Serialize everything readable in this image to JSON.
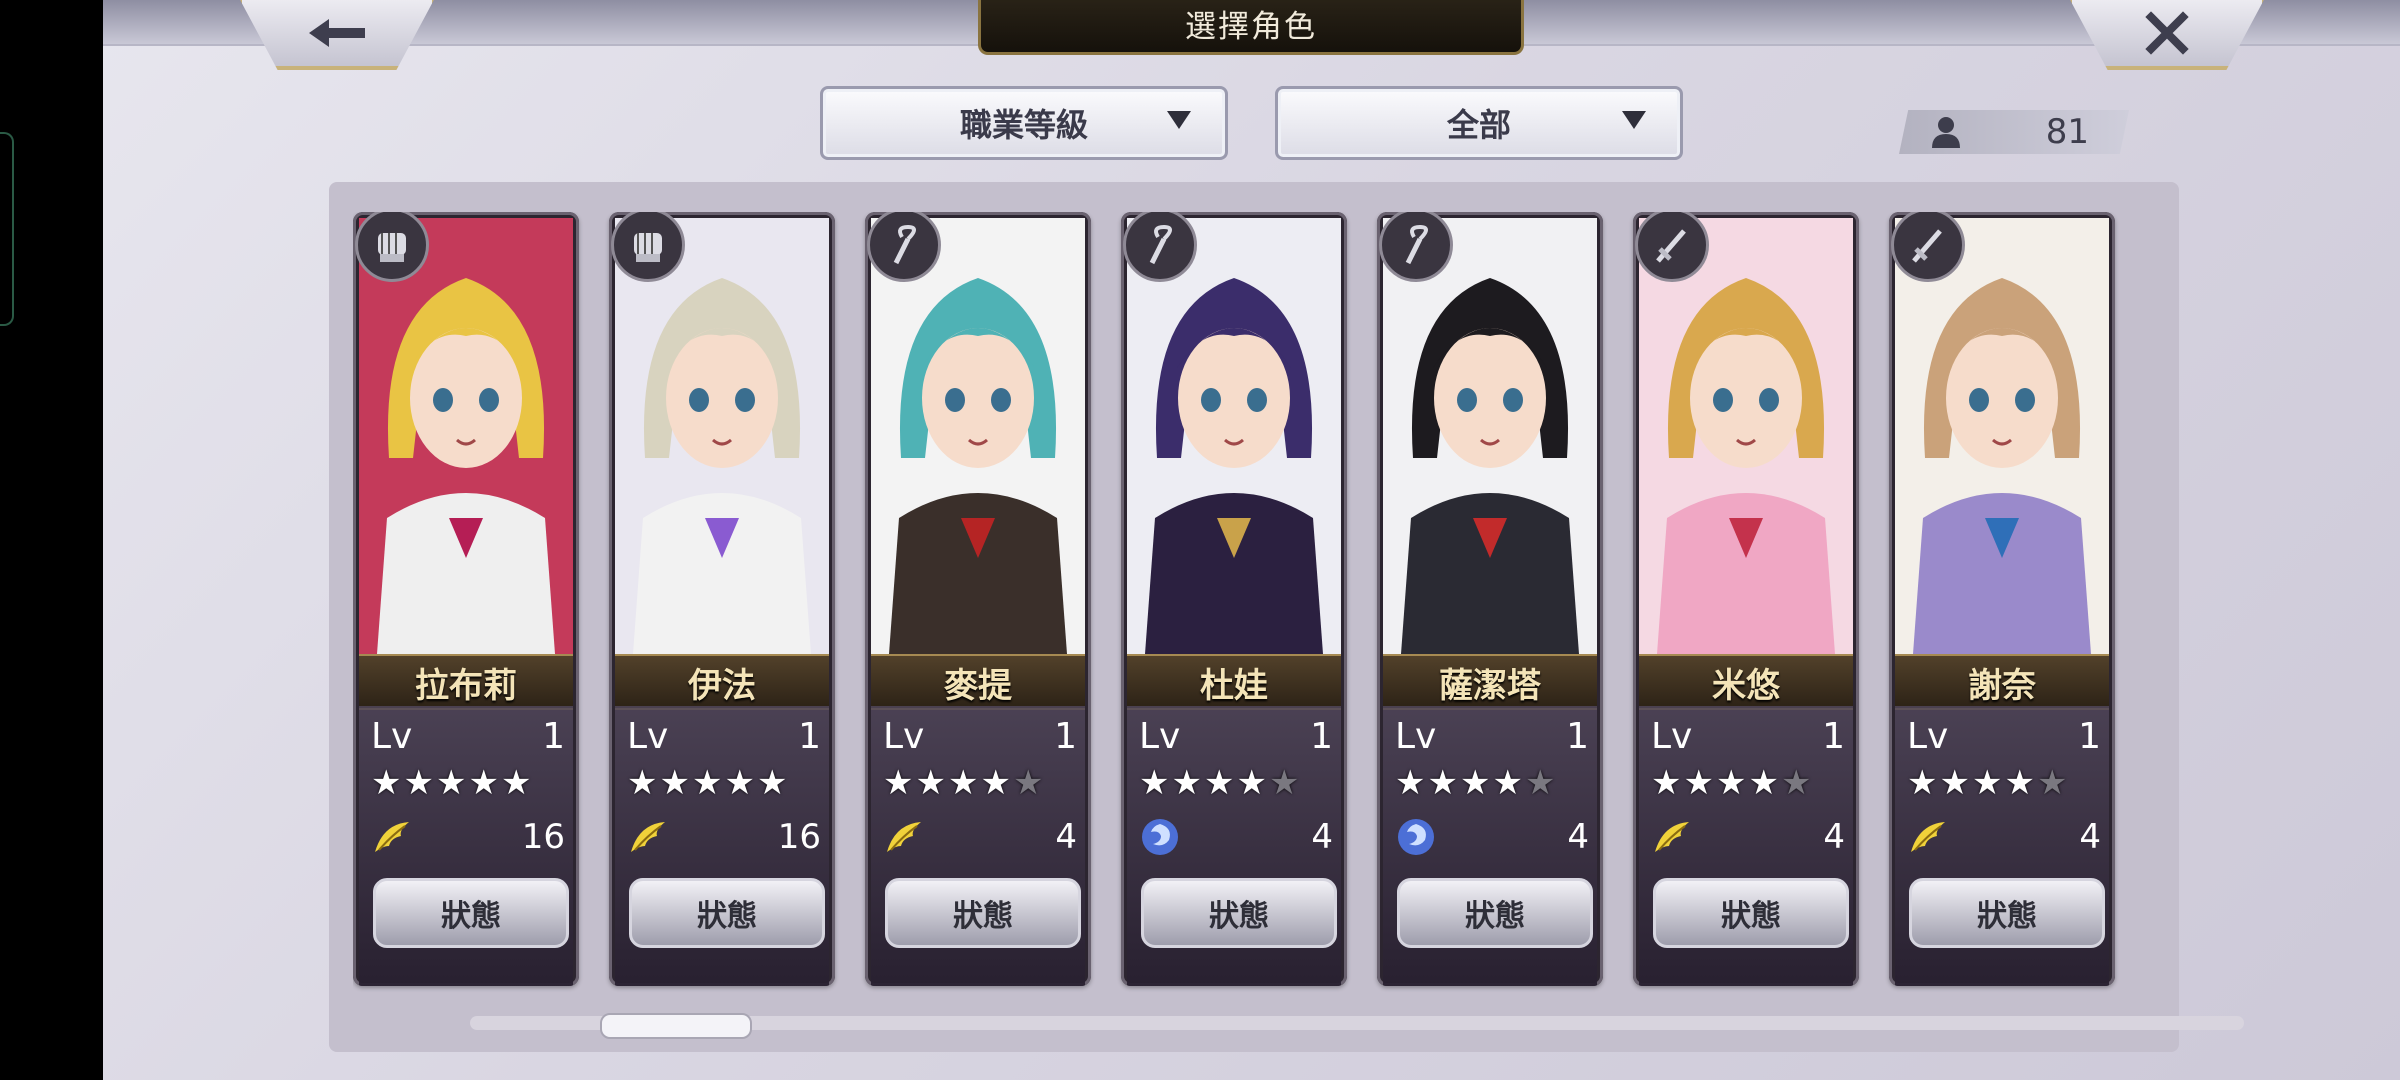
{
  "header": {
    "title": "選擇角色",
    "back_icon": "arrow-left-icon",
    "close_icon": "close-x-icon"
  },
  "filters": {
    "sort_label": "職業等級",
    "filter_label": "全部"
  },
  "roster": {
    "count": "81"
  },
  "cards": [
    {
      "name": "拉布莉",
      "lv_label": "Lv",
      "level": "1",
      "stars": 5,
      "max_stars": 5,
      "element_icon": "wind-leaf-icon",
      "element_value": "16",
      "class_icon": "fist-gauntlet-icon",
      "status_label": "狀態",
      "palette": {
        "hair": "#e9c444",
        "bg": "#c43a5a",
        "outfit": "#efefef",
        "accent": "#b51e55"
      }
    },
    {
      "name": "伊法",
      "lv_label": "Lv",
      "level": "1",
      "stars": 5,
      "max_stars": 5,
      "element_icon": "wind-leaf-icon",
      "element_value": "16",
      "class_icon": "fist-gauntlet-icon",
      "status_label": "狀態",
      "palette": {
        "hair": "#d8d3bf",
        "bg": "#e9e7f0",
        "outfit": "#f2f2f2",
        "accent": "#8a5bd1"
      }
    },
    {
      "name": "麥提",
      "lv_label": "Lv",
      "level": "1",
      "stars": 4,
      "max_stars": 5,
      "element_icon": "wind-leaf-icon",
      "element_value": "4",
      "class_icon": "staff-icon",
      "status_label": "狀態",
      "palette": {
        "hair": "#4fb2b5",
        "bg": "#f3f3f3",
        "outfit": "#3a2f2a",
        "accent": "#b52424"
      }
    },
    {
      "name": "杜娃",
      "lv_label": "Lv",
      "level": "1",
      "stars": 4,
      "max_stars": 5,
      "element_icon": "swirl-water-icon",
      "element_value": "4",
      "class_icon": "staff-icon",
      "status_label": "狀態",
      "palette": {
        "hair": "#3b2d6b",
        "bg": "#ededf3",
        "outfit": "#2b2040",
        "accent": "#c9a24a"
      }
    },
    {
      "name": "薩潔塔",
      "lv_label": "Lv",
      "level": "1",
      "stars": 4,
      "max_stars": 5,
      "element_icon": "swirl-water-icon",
      "element_value": "4",
      "class_icon": "staff-icon",
      "status_label": "狀態",
      "palette": {
        "hair": "#1d1b1f",
        "bg": "#f1f1f3",
        "outfit": "#2a2a33",
        "accent": "#c22b2b"
      }
    },
    {
      "name": "米悠",
      "lv_label": "Lv",
      "level": "1",
      "stars": 4,
      "max_stars": 5,
      "element_icon": "wind-leaf-icon",
      "element_value": "4",
      "class_icon": "sword-icon",
      "status_label": "狀態",
      "palette": {
        "hair": "#d9a84e",
        "bg": "#f5d9e3",
        "outfit": "#f0a7c4",
        "accent": "#c4324c"
      }
    },
    {
      "name": "謝奈",
      "lv_label": "Lv",
      "level": "1",
      "stars": 4,
      "max_stars": 5,
      "element_icon": "wind-leaf-icon",
      "element_value": "4",
      "class_icon": "sword-icon",
      "status_label": "狀態",
      "palette": {
        "hair": "#caa27a",
        "bg": "#f3efe9",
        "outfit": "#9a8acb",
        "accent": "#2f6fb8"
      }
    }
  ],
  "scroll": {
    "position": 0.08
  }
}
